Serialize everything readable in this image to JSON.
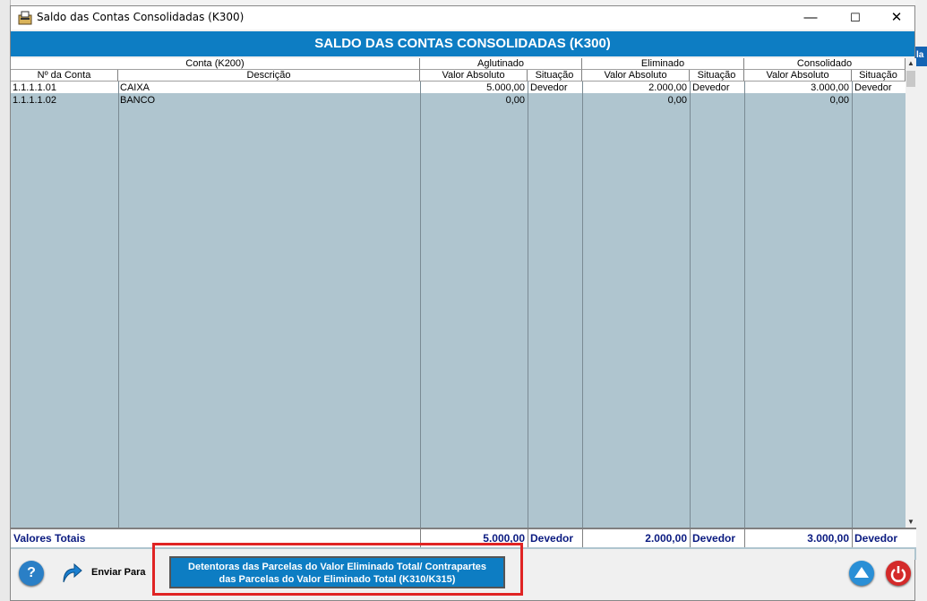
{
  "window": {
    "title": "Saldo das Contas Consolidadas (K300)",
    "minimize": "—",
    "maximize": "☐",
    "close": "✕"
  },
  "header": "SALDO DAS CONTAS CONSOLIDADAS (K300)",
  "background_right_label": "la",
  "grid": {
    "groups": {
      "conta": "Conta (K200)",
      "aglutinado": "Aglutinado",
      "eliminado": "Eliminado",
      "consolidado": "Consolidado"
    },
    "columns": {
      "numero": "Nº da Conta",
      "descricao": "Descrição",
      "aglutinado_valor": "Valor Absoluto",
      "aglutinado_situacao": "Situação",
      "eliminado_valor": "Valor Absoluto",
      "eliminado_situacao": "Situação",
      "consolidado_valor": "Valor Absoluto",
      "consolidado_situacao": "Situação"
    },
    "rows": [
      {
        "numero": "1.1.1.1.01",
        "descricao": "CAIXA",
        "ag_valor": "5.000,00",
        "ag_sit": "Devedor",
        "el_valor": "2.000,00",
        "el_sit": "Devedor",
        "co_valor": "3.000,00",
        "co_sit": "Devedor"
      },
      {
        "numero": "1.1.1.1.02",
        "descricao": "BANCO",
        "ag_valor": "0,00",
        "ag_sit": "",
        "el_valor": "0,00",
        "el_sit": "",
        "co_valor": "0,00",
        "co_sit": ""
      }
    ]
  },
  "totals": {
    "label": "Valores Totais",
    "ag_valor": "5.000,00",
    "ag_sit": "Devedor",
    "el_valor": "2.000,00",
    "el_sit": "Devedor",
    "co_valor": "3.000,00",
    "co_sit": "Devedor"
  },
  "bottom": {
    "help": "?",
    "send_to": "Enviar Para",
    "main_button_line1": "Detentoras das Parcelas  do Valor Eliminado Total/ Contrapartes",
    "main_button_line2": "das Parcelas do Valor Eliminado Total (K310/K315)"
  },
  "icons": {
    "app": "app-window-icon",
    "help": "help-icon",
    "send": "share-arrow-icon",
    "up": "up-arrow-icon",
    "power": "power-icon"
  },
  "colors": {
    "header": "#0d7dc3",
    "grid_bg": "#afc5cf",
    "totals_text": "#0a1a80",
    "highlight": "#e02424"
  }
}
